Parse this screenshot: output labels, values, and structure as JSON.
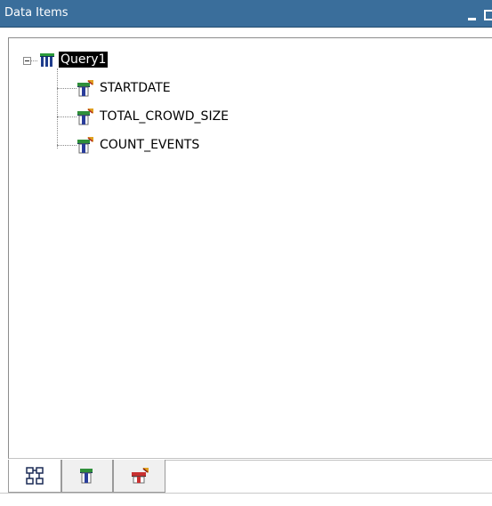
{
  "window": {
    "title": "Data Items"
  },
  "tree": {
    "root": {
      "label": "Query1",
      "icon": "query-table-icon",
      "expanded": true,
      "selected": true
    },
    "items": [
      {
        "label": "STARTDATE",
        "icon": "data-item-icon"
      },
      {
        "label": "TOTAL_CROWD_SIZE",
        "icon": "data-item-icon"
      },
      {
        "label": "COUNT_EVENTS",
        "icon": "data-item-icon"
      }
    ]
  },
  "tabs": [
    {
      "icon": "query-structure-icon",
      "active": true
    },
    {
      "icon": "data-items-icon",
      "active": false
    },
    {
      "icon": "filters-icon",
      "active": false
    }
  ],
  "colors": {
    "titlebar": "#3a6e9b",
    "selection": "#000000"
  }
}
